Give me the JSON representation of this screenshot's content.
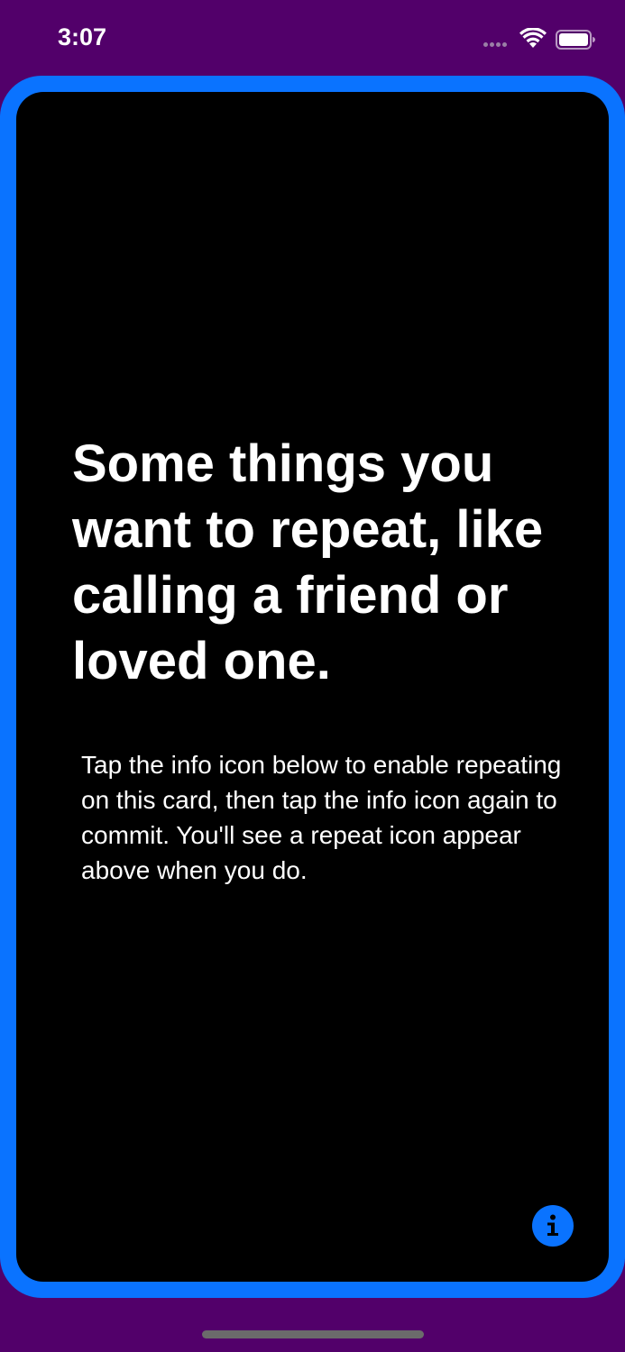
{
  "status_bar": {
    "time": "3:07",
    "signal_icon": "signal-dots-icon",
    "wifi_icon": "wifi-icon",
    "battery_icon": "battery-icon"
  },
  "card": {
    "headline": "Some things you want to repeat, like calling a friend or loved one.",
    "body": "Tap the info icon below to enable repeating on this card, then tap the info icon again to commit. You'll see a repeat icon appear above when you do.",
    "info_button_icon": "info-icon"
  },
  "colors": {
    "background": "#52006a",
    "card_border": "#0a73ff",
    "card_background": "#000000",
    "text": "#ffffff",
    "accent": "#0a73ff"
  }
}
